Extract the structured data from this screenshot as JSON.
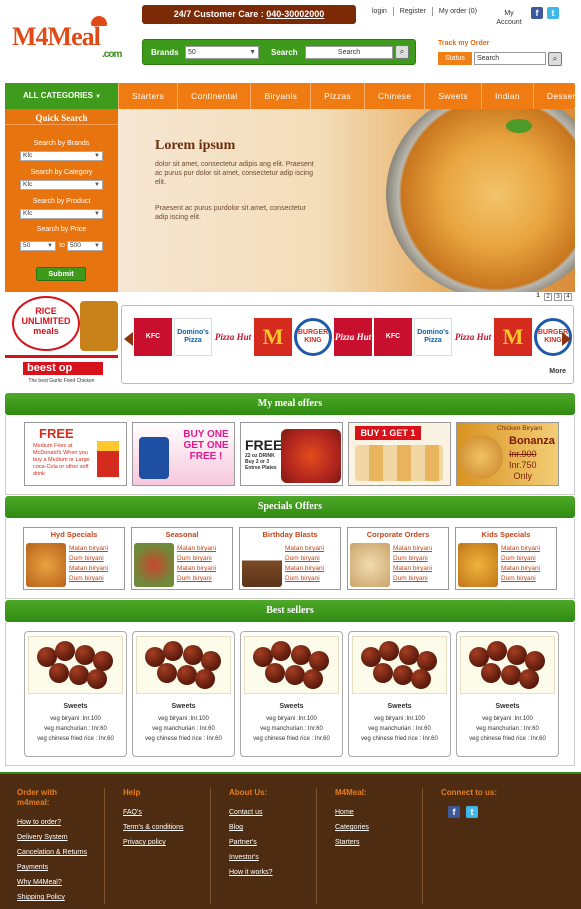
{
  "header": {
    "logo": "M4Meal",
    "logo_domain": ".com",
    "customer_care_label": "24/7 Customer Care :",
    "customer_care_phone": "040-30002000",
    "top_links": [
      "login",
      "Register",
      "My order (0)"
    ],
    "my_account": "My Account",
    "search": {
      "brands_label": "Brands",
      "brands_value": "50",
      "search_label": "Search",
      "search_value": "Search"
    },
    "track": {
      "title": "Track my Order",
      "status_label": "Status",
      "input_value": "Search"
    }
  },
  "nav": {
    "all_categories": "ALL CATEGORIES",
    "items": [
      "Starters",
      "Continental",
      "Biryanis",
      "Pizzas",
      "Chinese",
      "Sweets",
      "Indian",
      "Desserts"
    ]
  },
  "quick_search": {
    "title": "Quick Search",
    "by_brands": "Search by Brands",
    "brands_value": "Kfc",
    "by_category": "Search by Category",
    "category_value": "Kfc",
    "by_product": "Search by Product",
    "product_value": "Kfc",
    "by_price": "Search by Price",
    "price_from": "50",
    "price_to_label": "to",
    "price_to": "500",
    "submit": "Submit"
  },
  "hero": {
    "title": "Lorem ipsum",
    "para1": "dolor sit amet, consectetur adipis ang elit. Praesent ac purus pur dolor sit amet, consectetur adip iscing elit.",
    "para2": "Praesent ac purus purdolor sit amet, consectetur adip iscing elit.",
    "pages": [
      "1",
      "2",
      "3",
      "4"
    ]
  },
  "promo": {
    "rice": "RICE UNLIMITED meals",
    "brand": "beest op",
    "tagline": "The best Garlic Fried Chicken"
  },
  "brands": {
    "logos": [
      "KFC",
      "Domino's Pizza",
      "Pizza Hut",
      "M",
      "BURGER KING",
      "Pizza Hut",
      "KFC",
      "Domino's Pizza",
      "Pizza Hut",
      "M",
      "BURGER KING"
    ],
    "more": "More"
  },
  "meal_offers": {
    "title": "My meal offers",
    "offer1_big": "FREE",
    "offer1_small": "Medium Fries at McDonald's When you buy a Medium or Large coca-Cola or other soft drink",
    "offer2": "BUY ONE GET ONE FREE !",
    "offer3_big": "FREE",
    "offer3_small": "22 oz DRINK Buy 2 or 3 Entree Plates",
    "offer4": "BUY 1 GET 1 FREE",
    "offer5_title": "Chicken Biryani",
    "offer5_bonanza": "Bonanza",
    "offer5_old": "Inr.900",
    "offer5_new": "Inr.750",
    "offer5_only": "Only"
  },
  "specials": {
    "title": "Specials Offers",
    "cards": [
      {
        "title": "Hyd Specials",
        "links": [
          "Matan biryani",
          "Dum biryani",
          "Matan biryani",
          "Dum biryani"
        ]
      },
      {
        "title": "Seasonal",
        "links": [
          "Matan biryani",
          "Dum biryani",
          "Matan biryani",
          "Dum biryani"
        ]
      },
      {
        "title": "Birthday Blasts",
        "links": [
          "Matan biryani",
          "Dum biryani",
          "Matan biryani",
          "Dum biryani"
        ]
      },
      {
        "title": "Corporate Orders",
        "links": [
          "Matan biryani",
          "Dum biryani",
          "Matan biryani",
          "Dum biryani"
        ]
      },
      {
        "title": "Kids Specials",
        "links": [
          "Matan biryani",
          "Dum biryani",
          "Matan biryani",
          "Dum biryani"
        ]
      }
    ]
  },
  "bestsellers": {
    "title": "Best sellers",
    "items": [
      {
        "name": "Sweets",
        "l1": "veg biryani :Inr.100",
        "l2": "veg manchurian : Inr.60",
        "l3": "veg chinese fried rice : Inr.60"
      },
      {
        "name": "Sweets",
        "l1": "veg biryani :Inr.100",
        "l2": "veg manchurian : Inr.60",
        "l3": "veg chinese fried rice : Inr.60"
      },
      {
        "name": "Sweets",
        "l1": "veg biryani :Inr.100",
        "l2": "veg manchurian : Inr.60",
        "l3": "veg chinese fried rice : Inr.60"
      },
      {
        "name": "Sweets",
        "l1": "veg biryani :Inr.100",
        "l2": "veg manchurian : Inr.60",
        "l3": "veg chinese fried rice : Inr.60"
      },
      {
        "name": "Sweets",
        "l1": "veg biryani :Inr.100",
        "l2": "veg manchurian : Inr.60",
        "l3": "veg chinese fried rice : Inr.60"
      }
    ]
  },
  "footer": {
    "col1": {
      "title": "Order with m4meal:",
      "links": [
        "How to order?",
        "Delivery System",
        "Cancelation & Returns",
        "Payments",
        "Why M4Meal?",
        "Shipping Policy"
      ]
    },
    "col2": {
      "title": "Help",
      "links": [
        "FAQ's",
        "Term's & conditions",
        "Privacy policy"
      ]
    },
    "col3": {
      "title": "About Us:",
      "links": [
        "Contact us",
        "Blog",
        "Partner's",
        "Investor's",
        "How it works?"
      ]
    },
    "col4": {
      "title": "M4Meal:",
      "links": [
        "Home",
        "Categories",
        "Starters"
      ]
    },
    "col5": {
      "title": "Connect to us:"
    }
  },
  "colors": {
    "orange": "#f07b12",
    "green": "#3e9b1b",
    "brown": "#4d2c11"
  }
}
